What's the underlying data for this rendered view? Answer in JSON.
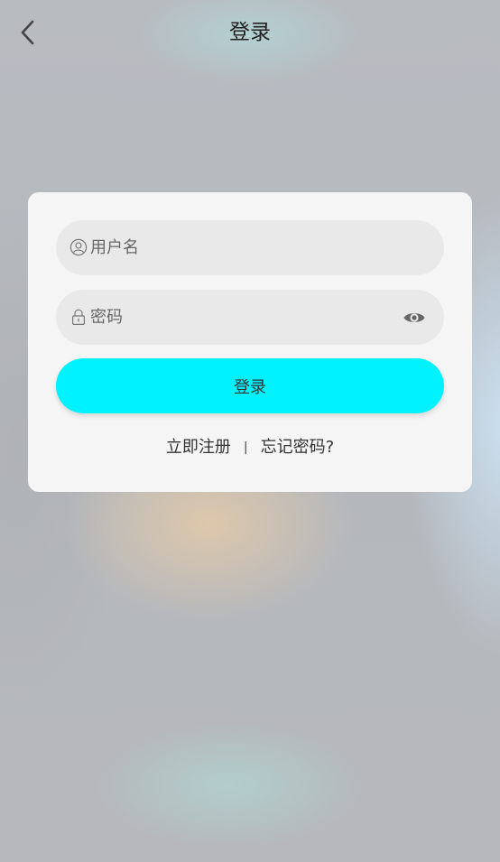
{
  "header": {
    "title": "登录",
    "back_icon": "chevron-left-icon"
  },
  "login_form": {
    "username": {
      "placeholder": "用户名",
      "value": "",
      "icon": "user-icon"
    },
    "password": {
      "placeholder": "密码",
      "value": "",
      "icon": "lock-icon",
      "visibility_icon": "eye-icon"
    },
    "submit_label": "登录",
    "register_link": "立即注册",
    "separator": "|",
    "forgot_link": "忘记密码?"
  },
  "colors": {
    "primary_button": "#00f2ff",
    "card_background": "#f5f5f5",
    "input_background": "#e9e9e9",
    "text": "#333333"
  }
}
